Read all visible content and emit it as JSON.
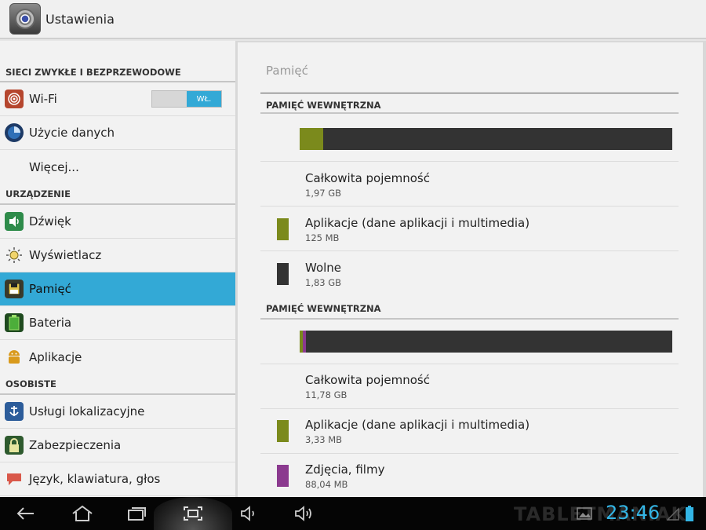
{
  "app": {
    "title": "Ustawienia"
  },
  "sidebar": {
    "sections": [
      {
        "label": "SIECI ZWYKŁE I BEZPRZEWODOWE"
      },
      {
        "label": "URZĄDZENIE"
      },
      {
        "label": "OSOBISTE"
      }
    ],
    "items": [
      {
        "label": "Wi-Fi",
        "icon": "wifi-icon",
        "toggle": "WŁ."
      },
      {
        "label": "Użycie danych",
        "icon": "data-usage-icon"
      },
      {
        "label": "Więcej...",
        "icon": ""
      },
      {
        "label": "Dźwięk",
        "icon": "speaker-icon"
      },
      {
        "label": "Wyświetlacz",
        "icon": "brightness-icon"
      },
      {
        "label": "Pamięć",
        "icon": "storage-icon",
        "selected": true
      },
      {
        "label": "Bateria",
        "icon": "battery-icon"
      },
      {
        "label": "Aplikacje",
        "icon": "android-icon"
      },
      {
        "label": "Usługi lokalizacyjne",
        "icon": "location-icon"
      },
      {
        "label": "Zabezpieczenia",
        "icon": "lock-icon"
      },
      {
        "label": "Język, klawiatura, głos",
        "icon": "language-icon"
      }
    ]
  },
  "main": {
    "title": "Pamięć",
    "storages": [
      {
        "header": "PAMIĘĆ WEWNĘTRZNA",
        "usage": [
          {
            "color": "#7b8a1c",
            "fraction": 0.063
          },
          {
            "color": "#6f6f6f",
            "fraction": 0.0
          }
        ],
        "rows": [
          {
            "title": "Całkowita pojemność",
            "value": "1,97 GB",
            "color": ""
          },
          {
            "title": "Aplikacje (dane aplikacji i multimedia)",
            "value": "125 MB",
            "color": "#7b8a1c"
          },
          {
            "title": "Wolne",
            "value": "1,83 GB",
            "color": "#333333"
          }
        ]
      },
      {
        "header": "PAMIĘĆ WEWNĘTRZNA",
        "usage": [
          {
            "color": "#7b8a1c",
            "fraction": 0.008
          },
          {
            "color": "#8b3a8f",
            "fraction": 0.008
          }
        ],
        "rows": [
          {
            "title": "Całkowita pojemność",
            "value": "11,78 GB",
            "color": ""
          },
          {
            "title": "Aplikacje (dane aplikacji i multimedia)",
            "value": "3,33 MB",
            "color": "#7b8a1c"
          },
          {
            "title": "Zdjęcia, filmy",
            "value": "88,04 MB",
            "color": "#8b3a8f"
          }
        ]
      }
    ]
  },
  "navbar": {
    "clock": "23:46",
    "watermark": "TABLETMANIAK",
    "accent": "#33b5e5",
    "icons": [
      "back-icon",
      "home-icon",
      "recent-apps-icon",
      "screenshot-icon",
      "volume-down-icon",
      "volume-up-icon",
      "gallery-icon",
      "signal-icon",
      "battery-icon"
    ]
  }
}
